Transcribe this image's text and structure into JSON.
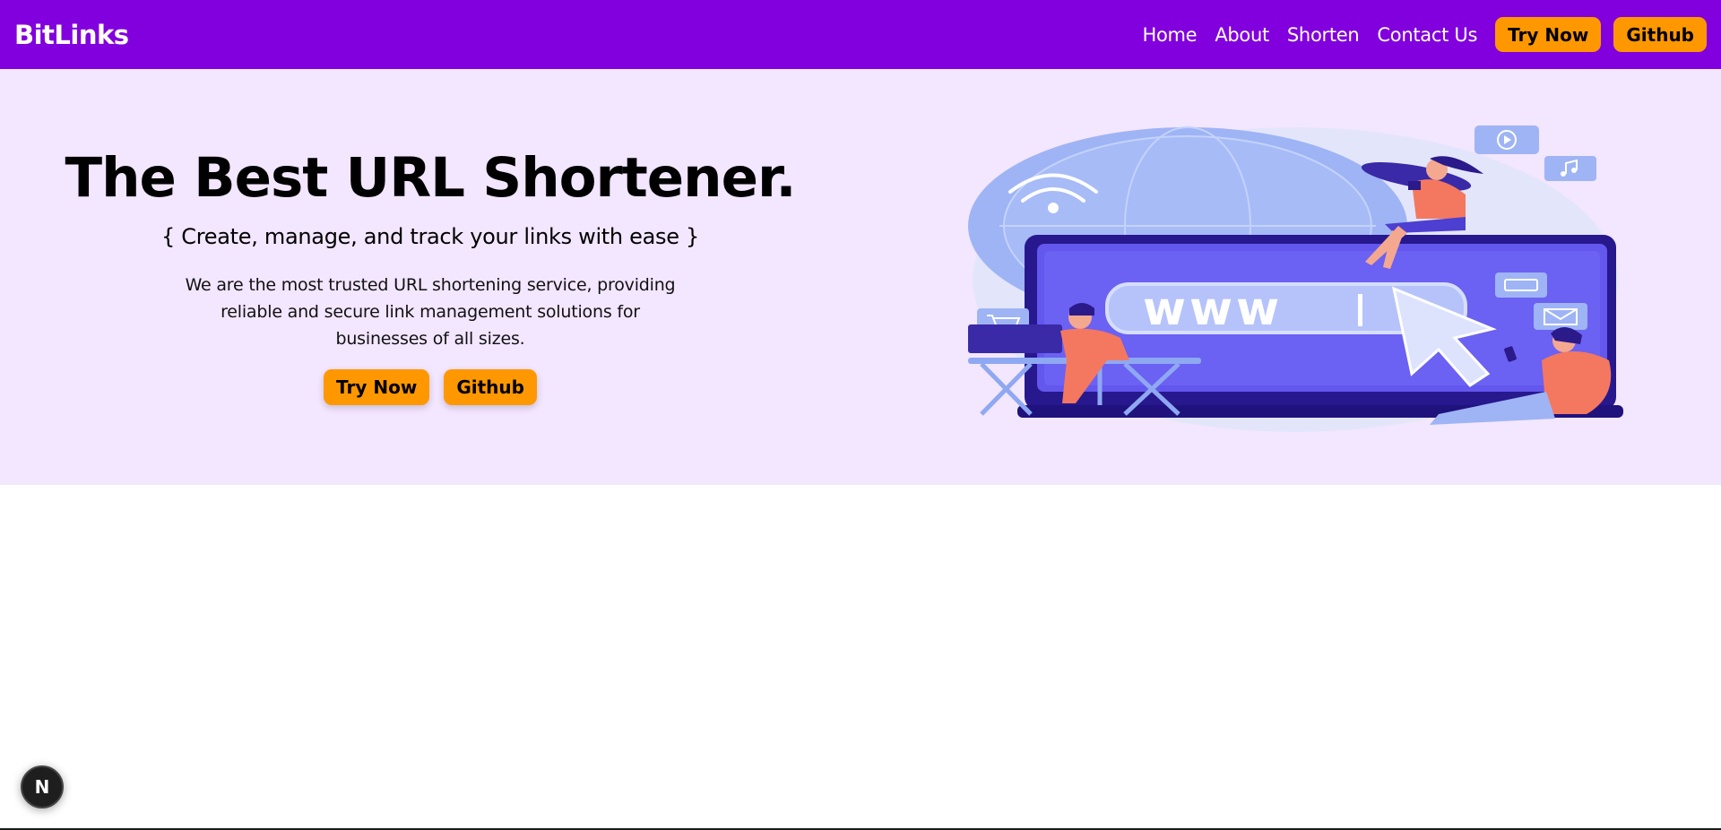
{
  "navbar": {
    "brand": "BitLinks",
    "links": [
      "Home",
      "About",
      "Shorten",
      "Contact Us"
    ],
    "buttons": [
      "Try Now",
      "Github"
    ],
    "background": "#8200de",
    "button_color": "#ff9800"
  },
  "hero": {
    "title": "The Best URL Shortener.",
    "subtitle": "{ Create, manage, and track your links with ease }",
    "description": "We are the most trusted URL shortening service, providing reliable and secure link management solutions for businesses of all sizes.",
    "buttons": [
      "Try Now",
      "Github"
    ],
    "background": "#f3e6ff",
    "illustration": {
      "name": "url-shortener-illustration",
      "screen_text": "www"
    }
  },
  "dev_badge": {
    "label": "N"
  }
}
